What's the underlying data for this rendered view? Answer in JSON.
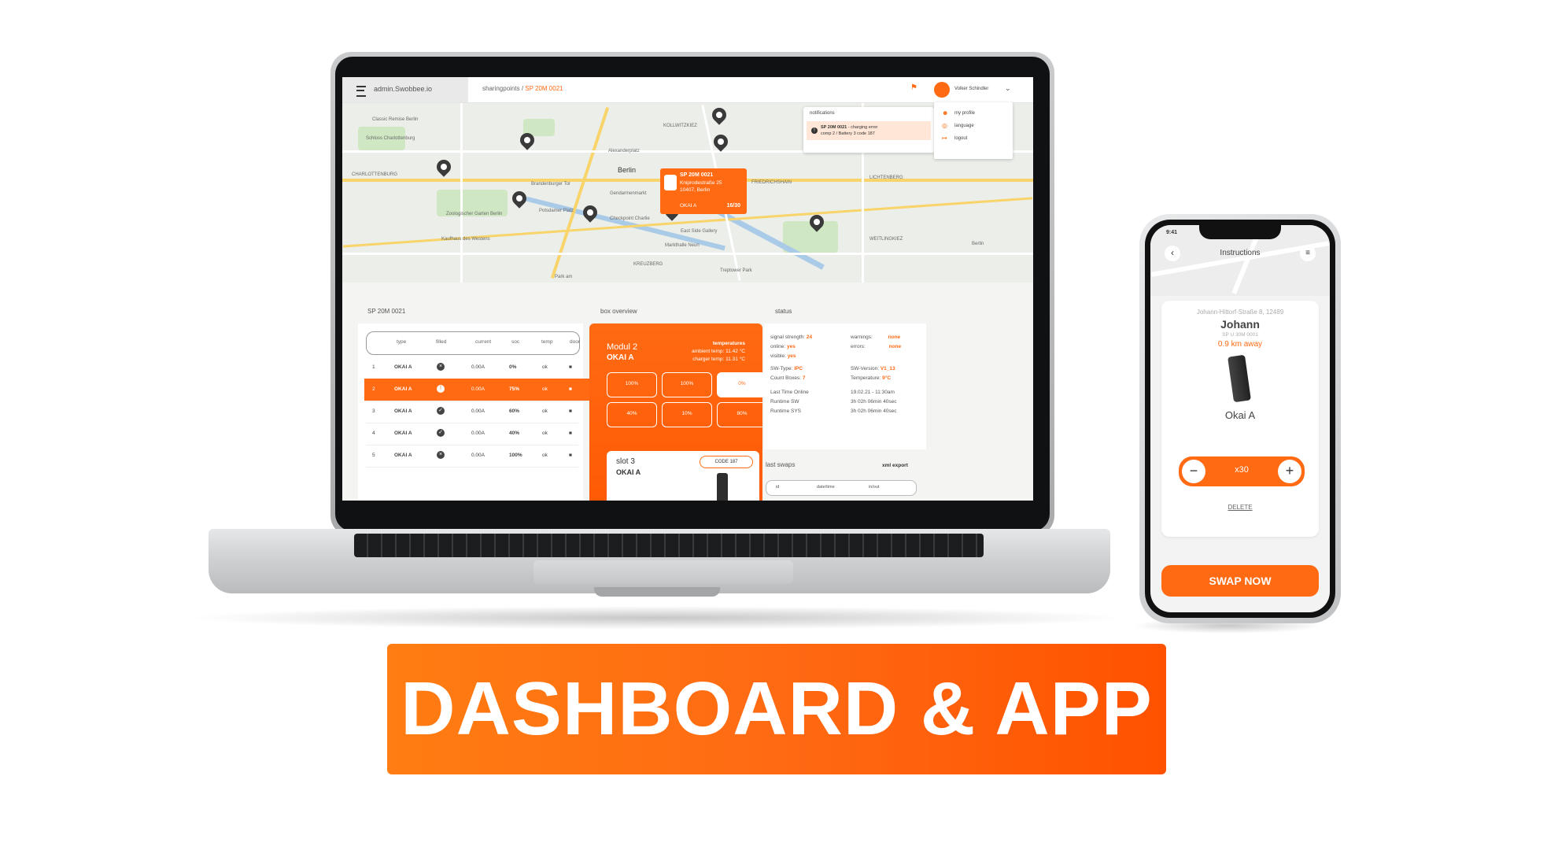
{
  "colors": {
    "accent": "#ff6a13",
    "dark": "#333333"
  },
  "dashboard": {
    "brand": "admin.Swobbee.io",
    "breadcrumb": {
      "root": "sharingpoints",
      "sep": " / ",
      "current": "SP 20M 0021"
    },
    "user": {
      "name": "Volker Schindler"
    },
    "user_menu": [
      "my profile",
      "language",
      "logout"
    ],
    "notifications": {
      "title": "notifications",
      "item_title": "SP 20M 0021",
      "item_text": " - charging error",
      "item_detail": "comp 2 / Battery 3 code 187"
    },
    "map": {
      "labels": [
        "Classic Remise Berlin",
        "Schloss Charlottenburg",
        "CHARLOTTENBURG",
        "Berlin",
        "Brandenburger Tor",
        "Alexanderplatz",
        "KOLLWITZKIEZ",
        "Gendarmenmarkt",
        "Potsdamer Platz",
        "Checkpoint Charlie",
        "Zoologischer Garten Berlin",
        "Kaufhaus des Westens",
        "East Side Gallery",
        "FRIEDRICHSHAIN",
        "LICHTENBERG",
        "KREUZBERG",
        "Markthalle Neun",
        "Treptower Park",
        "Berlin",
        "WEITLINGKIEZ",
        "Park am"
      ],
      "popup": {
        "title": "SP 20M 0021",
        "line1": "Kniprodestraße 25",
        "line2": "10407, Berlin",
        "model": "OKAI A",
        "count": "16/30"
      }
    },
    "left_panel": {
      "title": "SP 20M 0021",
      "columns": [
        "type",
        "filled",
        "current",
        "soc",
        "temp",
        "door"
      ],
      "rows": [
        {
          "num": "1",
          "type": "OKAI A",
          "current": "0.00A",
          "soc": "0%",
          "temp": "ok"
        },
        {
          "num": "2",
          "type": "OKAI A",
          "current": "0.00A",
          "soc": "75%",
          "temp": "ok"
        },
        {
          "num": "3",
          "type": "OKAI A",
          "current": "0.00A",
          "soc": "60%",
          "temp": "ok"
        },
        {
          "num": "4",
          "type": "OKAI A",
          "current": "0.00A",
          "soc": "40%",
          "temp": "ok"
        },
        {
          "num": "5",
          "type": "OKAI A",
          "current": "0.00A",
          "soc": "100%",
          "temp": "ok"
        }
      ]
    },
    "box_overview": {
      "title": "box overview",
      "module": "Modul 2",
      "model": "OKAI A",
      "temperatures_label": "temperatures",
      "ambient": "ambient temp: 11.42 °C",
      "charger": "charger temp: 11.31 °C",
      "slots": [
        "100%",
        "100%",
        "0%",
        "40%",
        "10%",
        "80%"
      ],
      "slot3": {
        "title": "slot 3",
        "model": "OKAI A",
        "code": "CODE 187"
      }
    },
    "status": {
      "title": "status",
      "signal_label": "signal strength:",
      "signal": "24",
      "online_label": "online:",
      "online": "yes",
      "visible_label": "visible:",
      "visible": "yes",
      "warnings_label": "warnings:",
      "warnings": "none",
      "errors_label": "errors:",
      "errors": "none",
      "swtype_label": "SW-Type:",
      "swtype": "IPC",
      "swversion_label": "SW-Version:",
      "swversion": "V1_13",
      "countboxes_label": "Count Boxes:",
      "countboxes": "7",
      "temperature_label": "Temperature:",
      "temperature": "9°C",
      "lasttime_label": "Last Time Online",
      "lasttime": "19.02.21 - 11:30am",
      "runtimesw_label": "Runtime SW",
      "runtimesw": "3h 02h 06min 40sec",
      "runtimesys_label": "Runtime SYS",
      "runtimesys": "3h 02h 06min 40sec"
    },
    "last_swaps": {
      "title": "last swaps",
      "export": "xml export",
      "columns": [
        "id",
        "date/time",
        "in/out"
      ]
    }
  },
  "app": {
    "time": "9:41",
    "title": "Instructions",
    "address": "Johann-Hittorf-Straße 8, 12489",
    "name": "Johann",
    "code": "SP U 30M 0001",
    "distance": "0.9 km away",
    "battery": "Okai A",
    "qty": "x30",
    "delete": "DELETE",
    "swap": "SWAP NOW"
  },
  "banner": {
    "text": "DASHBOARD & APP"
  }
}
